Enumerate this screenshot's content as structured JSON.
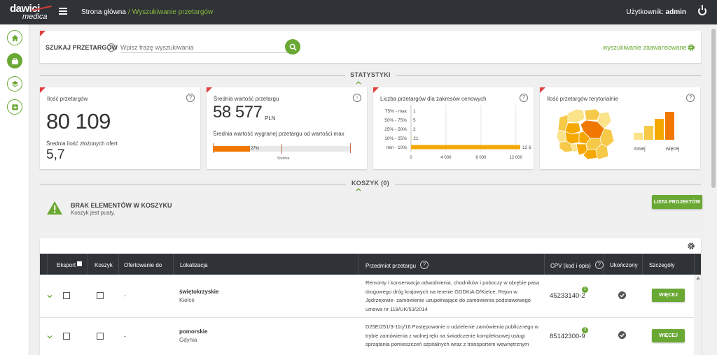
{
  "topbar": {
    "logo_text_top": "dawici",
    "logo_text_bottom": "medica",
    "breadcrumb_home": "Strona główna",
    "breadcrumb_separator": "/",
    "breadcrumb_current": "Wyszukiwanie przetargów",
    "user_label": "Użytkownik:",
    "user_name": "admin"
  },
  "sidebar": {
    "items": [
      {
        "icon": "home-icon"
      },
      {
        "icon": "briefcase-icon",
        "active": true
      },
      {
        "icon": "layers-icon"
      },
      {
        "icon": "plus-box-icon"
      }
    ]
  },
  "search": {
    "label": "SZUKAJ PRZETARGÓW",
    "placeholder": "Wpisz frazę wyszukiwania",
    "advanced_label": "wyszukiwanie zaawansowane"
  },
  "sections": {
    "stats_label": "STATYSTYKI",
    "cart_label": "KOSZYK (0)"
  },
  "stats": {
    "count": {
      "title": "Ilość przetargów",
      "value": "80 109",
      "sub_label": "Średnia ilość złożonych ofert",
      "sub_value": "5,7"
    },
    "avg_value": {
      "title": "Średnia wartość przetargu",
      "value": "58 577",
      "unit": "PLN",
      "sub_label": "Średnia wartość wygranej przetargu od wartości max",
      "percent_label": "27%",
      "percent": 27,
      "avg_marker_label": "Średnia",
      "avg_marker_percent": 50
    },
    "price_ranges": {
      "title": "Liczba przetargów dla zakresów cenowych"
    },
    "territorial": {
      "title": "Ilość przetargów terytorialnie",
      "legend_less": "mniej",
      "legend_more": "więcej"
    }
  },
  "chart_data": {
    "type": "bar",
    "orientation": "horizontal",
    "categories": [
      "75% - max",
      "50% - 75%",
      "25% - 50%",
      "10% - 25%",
      "min - 10%"
    ],
    "values": [
      1,
      5,
      2,
      21,
      12600
    ],
    "value_labels": [
      "1",
      "5",
      "2",
      "21",
      "12 6"
    ],
    "xticks": [
      "0",
      "4 000",
      "8 000",
      "12 000"
    ],
    "xlim": [
      0,
      12500
    ],
    "bar_color": "#f5a800"
  },
  "territorial_legend": {
    "type": "bar",
    "values": [
      1,
      2,
      3,
      4
    ],
    "colors": [
      "#fbe38a",
      "#f7c948",
      "#f5a800",
      "#f07800"
    ]
  },
  "cart": {
    "empty_title": "BRAK ELEMENTÓW W KOSZYKU",
    "empty_sub": "Koszyk jest pusty.",
    "projects_button": "LISTA PROJEKTÓW"
  },
  "table": {
    "headers": {
      "eksport": "Eksport",
      "koszyk": "Koszyk",
      "ofertowanie": "Ofertowanie do",
      "lokalizacja": "Lokalizacja",
      "przedmiot": "Przedmiot przetargu",
      "cpv": "CPV (kod i opis)",
      "ukonczony": "Ukończony",
      "szczegoly": "Szczegóły"
    },
    "rows": [
      {
        "ofertowanie": "-",
        "region": "świętokrzyskie",
        "city": "Kielce",
        "subject": "Remonty i konserwacja odwodnienia, chodników i poboczy w obrębie pasa drogowego dróg krajowych na terenie GDDKiA O/Kielce, Rejon w Jędrzejowie- zamówienie uzupełniające do zamówienia podstawowego umowa nr 118/UK/53/2014",
        "cpv": "45233140-2",
        "cpv_count": "1",
        "details_label": "WIĘCEJ"
      },
      {
        "ofertowanie": "-",
        "region": "pomorskie",
        "city": "Gdynia",
        "subject": "D25E/251/3-11rj/16 Postępowanie o udzielenie zamówienia publicznego w trybie zamówienia z wolnej ręki na świadczenie kompleksowej usługi sprzątania pomieszczeń szpitalnych wraz z transportem wewnętrznym",
        "cpv": "85142300-9",
        "cpv_count": "3",
        "details_label": "WIĘCEJ"
      }
    ]
  },
  "colors": {
    "accent_green": "#6aa834",
    "topbar": "#2f3337",
    "orange": "#f07800",
    "flag_red": "#e04040"
  }
}
